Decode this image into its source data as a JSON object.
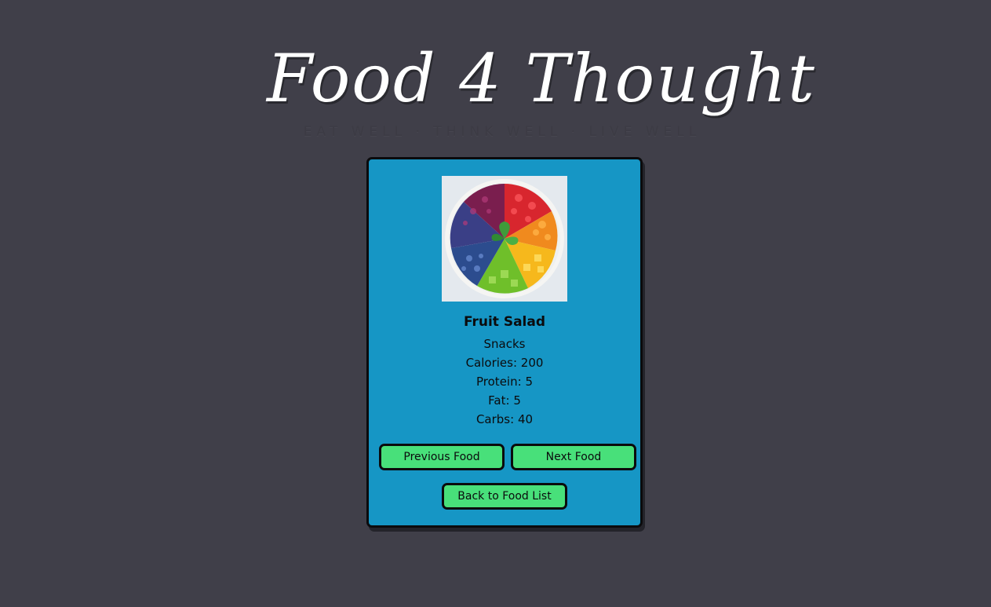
{
  "header": {
    "title": "Food 4 Thought",
    "tagline": "EAT WELL · THINK WELL · LIVE WELL"
  },
  "food": {
    "name": "Fruit Salad",
    "category": "Snacks",
    "calories_label": "Calories:",
    "calories": "200",
    "protein_label": "Protein:",
    "protein": "5",
    "fat_label": "Fat:",
    "fat": "5",
    "carbs_label": "Carbs:",
    "carbs": "40",
    "image_alt": "Fruit Salad"
  },
  "buttons": {
    "previous": "Previous Food",
    "next": "Next Food",
    "back": "Back to Food List"
  },
  "colors": {
    "background": "#403f49",
    "card": "#1696c5",
    "button": "#48e07a",
    "border": "#0b0b0d"
  }
}
